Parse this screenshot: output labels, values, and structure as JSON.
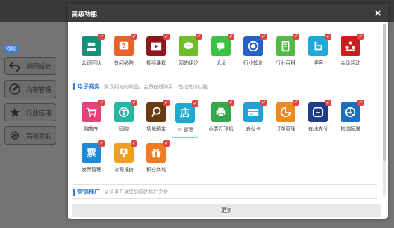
{
  "background": {
    "collapse_label": "收起",
    "side_buttons": [
      {
        "label": "返回设计",
        "icon": "undo-icon"
      },
      {
        "label": "内容管理",
        "icon": "edit-icon"
      },
      {
        "label": "行业应用",
        "icon": "star-icon"
      },
      {
        "label": "高级功能",
        "icon": "gear-icon"
      }
    ]
  },
  "modal": {
    "title": "高级功能",
    "close_glyph": "×",
    "more_label": "更多"
  },
  "top_section": {
    "tiles": [
      {
        "label": "公司团队",
        "color": "#17907a",
        "icon": "team-icon"
      },
      {
        "label": "有问必答",
        "color": "#e8622a",
        "icon": "question-icon"
      },
      {
        "label": "视频课程",
        "color": "#8c1a1a",
        "icon": "video-icon"
      },
      {
        "label": "网站评论",
        "color": "#6fbd2a",
        "icon": "comment-icon"
      },
      {
        "label": "论坛",
        "color": "#3cc244",
        "icon": "forum-icon"
      },
      {
        "label": "行业知道",
        "color": "#2462c8",
        "icon": "knowledge-icon"
      },
      {
        "label": "行业百科",
        "color": "#55b848",
        "icon": "encyclopedia-icon"
      },
      {
        "label": "博客",
        "color": "#1fa9d6",
        "icon": "blog-icon"
      },
      {
        "label": "会议活动",
        "color": "#c81f1f",
        "icon": "meeting-icon"
      }
    ]
  },
  "ecommerce": {
    "title": "电子商务",
    "desc": "实现网站的商品，会员在线购买，在线支付功能",
    "tiles": [
      {
        "label": "购物车",
        "color": "#e8417a",
        "icon": "cart-icon"
      },
      {
        "label": "团购",
        "color": "#27b6a3",
        "icon": "group-buy-icon"
      },
      {
        "label": "场地预定",
        "color": "#6a3a12",
        "icon": "reservation-icon"
      },
      {
        "label": "管理",
        "color": "#1ea9d0",
        "icon": "store-icon",
        "glyph": "店"
      },
      {
        "label": "小票打印机",
        "color": "#32a84a",
        "icon": "printer-icon"
      },
      {
        "label": "支付卡",
        "color": "#23a0d8",
        "icon": "card-icon"
      },
      {
        "label": "订单管理",
        "color": "#f08a1c",
        "icon": "order-icon"
      },
      {
        "label": "在线支付",
        "color": "#1d3e8c",
        "icon": "pay-icon"
      },
      {
        "label": "物流配送",
        "color": "#1a6fc0",
        "icon": "logistics-icon"
      },
      {
        "label": "发票管理",
        "color": "#1d8ad8",
        "icon": "invoice-icon",
        "glyph": "票"
      },
      {
        "label": "公司报价",
        "color": "#f0a020",
        "icon": "quote-icon"
      },
      {
        "label": "积分商城",
        "color": "#f07a20",
        "icon": "gift-icon"
      }
    ]
  },
  "marketing": {
    "title": "营销推广",
    "desc": "从这里开启您的网站推广之旅"
  }
}
